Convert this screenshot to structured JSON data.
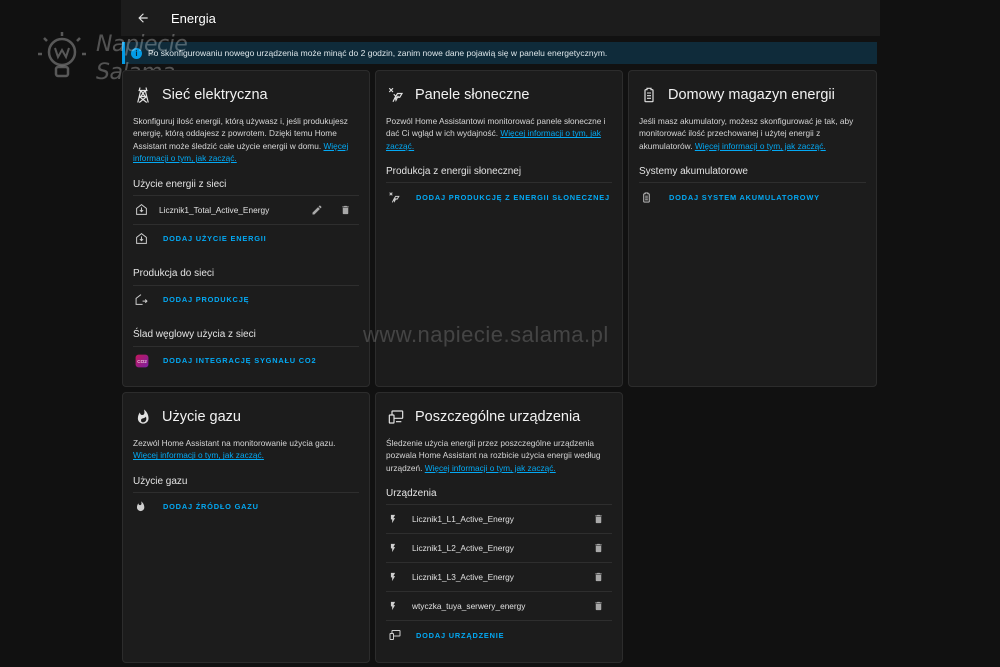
{
  "header": {
    "back_icon": "arrow-left-icon",
    "title": "Energia"
  },
  "alert": {
    "icon": "info-icon",
    "text": "Po skonfigurowaniu nowego urządzenia może minąć do 2 godzin, zanim nowe dane pojawią się w panelu energetycznym."
  },
  "logo": {
    "line1": "Napięcie",
    "line2": "Salama"
  },
  "watermark": "www.napiecie.salama.pl",
  "grid": {
    "icon": "transmission-tower-icon",
    "title": "Sieć elektryczna",
    "desc": "Skonfiguruj ilość energii, którą używasz i, jeśli produkujesz energię, którą oddajesz z powrotem. Dzięki temu Home Assistant może śledzić całe użycie energii w domu.",
    "link": "Więcej informacji o tym, jak zacząć.",
    "consumption_title": "Użycie energii z sieci",
    "consumption_item": "Licznik1_Total_Active_Energy",
    "add_consumption": "DODAJ UŻYCIE ENERGII",
    "production_title": "Produkcja do sieci",
    "add_production": "DODAJ PRODUKCJĘ",
    "co2_title": "Ślad węglowy użycia z sieci",
    "add_co2": "DODAJ INTEGRACJĘ SYGNAŁU CO2"
  },
  "solar": {
    "icon": "solar-power-icon",
    "title": "Panele słoneczne",
    "desc": "Pozwól Home Assistantowi monitorować panele słoneczne i dać Ci wgląd w ich wydajność.",
    "link": "Więcej informacji o tym, jak zacząć.",
    "section": "Produkcja z energii słonecznej",
    "add": "DODAJ PRODUKCJĘ Z ENERGII SŁONECZNEJ"
  },
  "battery": {
    "icon": "battery-icon",
    "title": "Domowy magazyn energii",
    "desc": "Jeśli masz akumulatory, możesz skonfigurować je tak, aby monitorować ilość przechowanej i użytej energii z akumulatorów.",
    "link": "Więcej informacji o tym, jak zacząć.",
    "section": "Systemy akumulatorowe",
    "add": "DODAJ SYSTEM AKUMULATOROWY"
  },
  "gas": {
    "icon": "fire-icon",
    "title": "Użycie gazu",
    "desc": "Zezwól Home Assistant na monitorowanie użycia gazu.",
    "link": "Więcej informacji o tym, jak zacząć.",
    "section": "Użycie gazu",
    "add": "DODAJ ŹRÓDŁO GAZU"
  },
  "devices": {
    "icon": "devices-icon",
    "title": "Poszczególne urządzenia",
    "desc": "Śledzenie użycia energii przez poszczególne urządzenia pozwala Home Assistant na rozbicie użycia energii według urządzeń.",
    "link": "Więcej informacji o tym, jak zacząć.",
    "section": "Urządzenia",
    "items": [
      "Licznik1_L1_Active_Energy",
      "Licznik1_L2_Active_Energy",
      "Licznik1_L3_Active_Energy",
      "wtyczka_tuya_serwery_energy"
    ],
    "add": "DODAJ URZĄDZENIE"
  }
}
